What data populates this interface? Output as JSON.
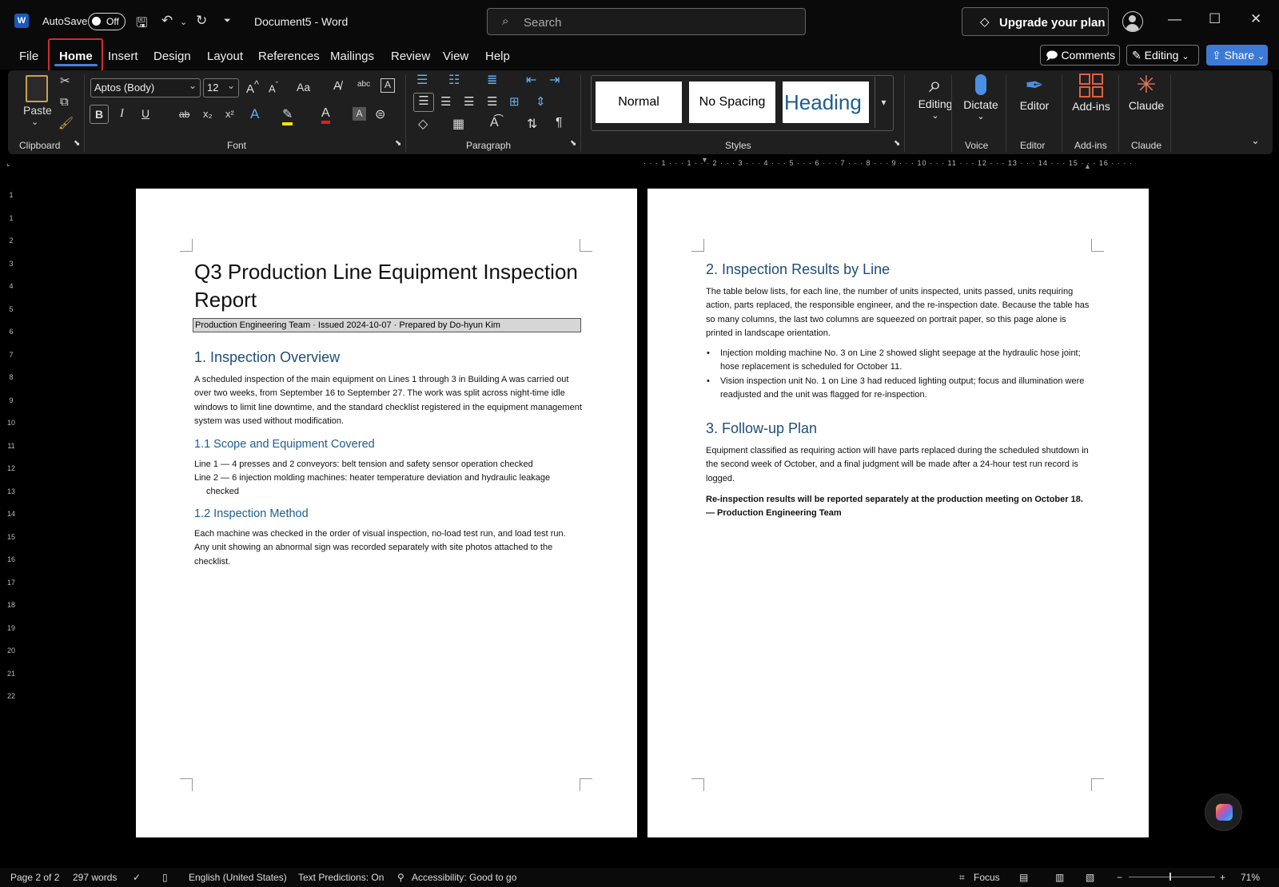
{
  "titlebar": {
    "app_icon": "W",
    "autosave_label": "AutoSave",
    "autosave_state": "Off",
    "document_title": "Document5 - Word",
    "search_placeholder": "Search",
    "upgrade_label": "Upgrade your plan"
  },
  "menu": {
    "tabs": [
      "File",
      "Home",
      "Insert",
      "Design",
      "Layout",
      "References",
      "Mailings",
      "Review",
      "View",
      "Help"
    ],
    "active_tab": "Home",
    "comments_label": "Comments",
    "editing_label": "Editing",
    "share_label": "Share"
  },
  "ribbon": {
    "clipboard": {
      "paste_label": "Paste",
      "group_label": "Clipboard"
    },
    "font": {
      "font_name": "Aptos (Body)",
      "font_size": "12",
      "group_label": "Font",
      "bold": "B",
      "italic": "I",
      "underline": "U",
      "strike": "ab",
      "subscript": "x₂",
      "superscript": "x²",
      "case": "Aa"
    },
    "paragraph": {
      "group_label": "Paragraph"
    },
    "styles": {
      "items": [
        "Normal",
        "No Spacing",
        "Heading 1"
      ],
      "group_label": "Styles"
    },
    "editing": {
      "label": "Editing"
    },
    "voice": {
      "label": "Dictate",
      "group_label": "Voice"
    },
    "editor": {
      "label": "Editor",
      "group_label": "Editor"
    },
    "addins": {
      "label": "Add-ins",
      "group_label": "Add-ins"
    },
    "claude": {
      "label": "Claude",
      "group_label": "Claude"
    }
  },
  "ruler": {
    "h_marks": "· · · 1 · · · 1 · · · 2 · · · 3 · · · 4 · · · 5 · · · 6 · · · 7 · · · 8 · · · 9 · · · 10 · · · 11 · · · 12 · · · 13 · · · 14 · · · 15 · · · 16 · · · ·",
    "v_marks": [
      "",
      "",
      "",
      "1",
      "",
      "1",
      "2",
      "3",
      "4",
      "5",
      "6",
      "7",
      "8",
      "9",
      "10",
      "11",
      "12",
      "13",
      "14",
      "15",
      "16",
      "17",
      "18",
      "19",
      "20",
      "21",
      "22",
      ""
    ]
  },
  "page1": {
    "title": "Q3 Production Line Equipment Inspection Report",
    "subtitle": "Production Engineering Team · Issued 2024-10-07 · Prepared by Do-hyun Kim",
    "h_overview": "1. Inspection Overview",
    "p_overview": "A scheduled inspection of the main equipment on Lines 1 through 3 in Building A was carried out over two weeks, from September 16 to September 27. The work was split across night-time idle windows to limit line downtime, and the standard checklist registered in the equipment management system was used without modification.",
    "h_scope": "1.1 Scope and Equipment Covered",
    "scope_line1": "Line 1 — 4 presses and 2 conveyors: belt tension and safety sensor operation checked",
    "scope_line2": "Line 2 — 6 injection molding machines: heater temperature deviation and hydraulic leakage checked",
    "h_method": "1.2 Inspection Method",
    "p_method": "Each machine was checked in the order of visual inspection, no-load test run, and load test run. Any unit showing an abnormal sign was recorded separately with site photos attached to the checklist."
  },
  "page2": {
    "h_results": "2. Inspection Results by Line",
    "p_results": "The table below lists, for each line, the number of units inspected, units passed, units requiring action, parts replaced, the responsible engineer, and the re-inspection date. Because the table has so many columns, the last two columns are squeezed on portrait paper, so this page alone is printed in landscape orientation.",
    "bullets": [
      "Injection molding machine No. 3 on Line 2 showed slight seepage at the hydraulic hose joint; hose replacement is scheduled for October 11.",
      "Vision inspection unit No. 1 on Line 3 had reduced lighting output; focus and illumination were readjusted and the unit was flagged for re-inspection."
    ],
    "h_followup": "3. Follow-up Plan",
    "p_followup": "Equipment classified as requiring action will have parts replaced during the scheduled shutdown in the second week of October, and a final judgment will be made after a 24-hour test run record is logged.",
    "p_final": "Re-inspection results will be reported separately at the production meeting on October 18. — Production Engineering Team"
  },
  "status": {
    "page": "Page 2 of 2",
    "words": "297 words",
    "language": "English (United States)",
    "predictions": "Text Predictions: On",
    "accessibility": "Accessibility: Good to go",
    "focus": "Focus",
    "zoom": "71%"
  }
}
